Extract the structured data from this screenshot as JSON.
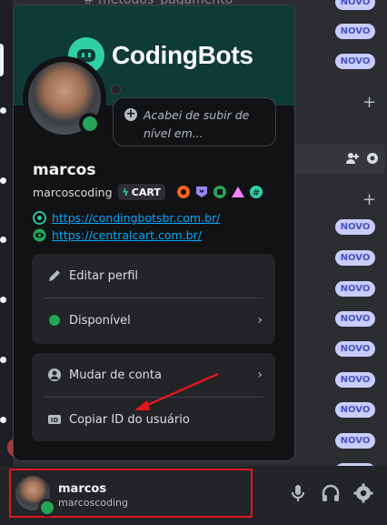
{
  "background": {
    "top_channel_text": "# metodos_pagamento",
    "novo_label": "NOVO",
    "novo_rows": 13
  },
  "profile": {
    "banner_brand": "CodingBots",
    "status_placeholder": "Acabei de subir de nível em...",
    "display_name": "marcos",
    "username": "marcoscoding",
    "tag": "CART",
    "badges": [
      "orange-badge-icon",
      "hypesquad-badge-icon",
      "active-dev-badge-icon",
      "pink-triangle-badge-icon",
      "hashtag-badge-icon"
    ],
    "links": [
      {
        "text": "https://condingbotsbr.com.br/",
        "icon": "codingbots-link-icon"
      },
      {
        "text": "https://centralcart.com.br/",
        "icon": "centralcart-link-icon"
      }
    ],
    "menu1": {
      "edit_profile": "Editar perfil",
      "status": "Disponível"
    },
    "menu2": {
      "switch_account": "Mudar de conta",
      "copy_id": "Copiar ID do usuário"
    }
  },
  "user_bar": {
    "display_name": "marcos",
    "username": "marcoscoding"
  },
  "colors": {
    "online": "#23a55a",
    "highlight_box": "#e0161f",
    "annotation_arrow": "#e0161f",
    "link": "#00a8fc"
  }
}
